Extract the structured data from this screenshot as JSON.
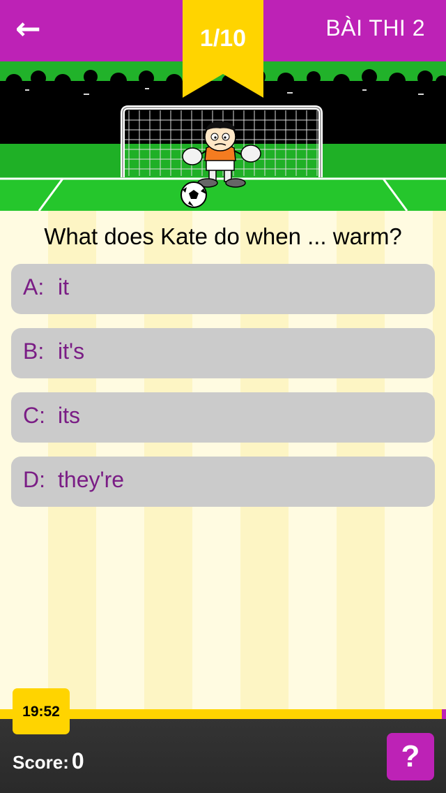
{
  "header": {
    "back_icon": "left-arrow-icon",
    "title": "BÀI THI 2",
    "progress": "1/10",
    "accent_color": "#bd22b6",
    "ribbon_color": "#ffd400"
  },
  "question": {
    "text": "What does Kate do when ... warm?"
  },
  "answers": [
    {
      "letter": "A:",
      "text": "it"
    },
    {
      "letter": "B:",
      "text": "it's"
    },
    {
      "letter": "C:",
      "text": "its"
    },
    {
      "letter": "D:",
      "text": "they're"
    }
  ],
  "footer": {
    "timer": "19:52",
    "score_label": "Score:",
    "score_value": "0",
    "help_label": "?"
  }
}
